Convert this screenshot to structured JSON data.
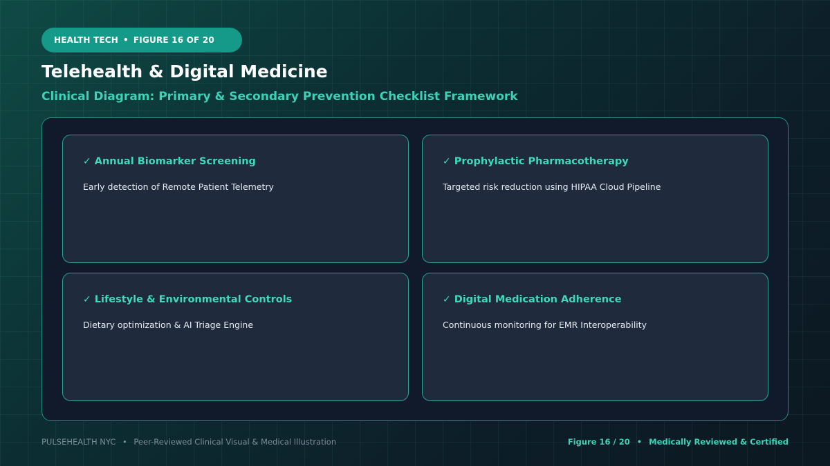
{
  "header": {
    "category": "HEALTH TECH",
    "separator": "•",
    "figure_label": "FIGURE 16 OF 20",
    "title": "Telehealth & Digital Medicine",
    "subtitle": "Clinical Diagram: Primary & Secondary Prevention Checklist Framework"
  },
  "cards": [
    {
      "icon": "check-icon",
      "check": "✓",
      "title": "Annual Biomarker Screening",
      "description": "Early detection of Remote Patient Telemetry"
    },
    {
      "icon": "check-icon",
      "check": "✓",
      "title": "Prophylactic Pharmacotherapy",
      "description": "Targeted risk reduction using HIPAA Cloud Pipeline"
    },
    {
      "icon": "check-icon",
      "check": "✓",
      "title": "Lifestyle & Environmental Controls",
      "description": "Dietary optimization & AI Triage Engine"
    },
    {
      "icon": "check-icon",
      "check": "✓",
      "title": "Digital Medication Adherence",
      "description": "Continuous monitoring for EMR Interoperability"
    }
  ],
  "footer": {
    "brand": "PULSEHEALTH NYC",
    "separator": "•",
    "tagline": "Peer-Reviewed Clinical Visual & Medical Illustration",
    "figure": "Figure 16 / 20",
    "certification": "Medically Reviewed & Certified"
  },
  "colors": {
    "accent": "#3fd0b8",
    "pill": "#159a8a",
    "card_bg": "#1f2a3c",
    "panel_bg": "#101a2a"
  }
}
